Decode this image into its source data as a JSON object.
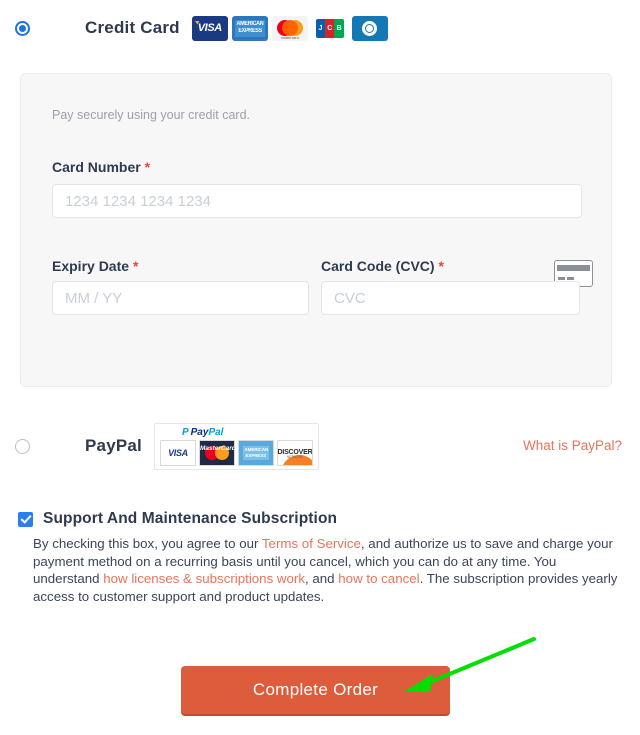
{
  "payment_methods": [
    {
      "id": "credit-card",
      "label": "Credit Card",
      "selected": true,
      "accepted_cards": [
        "visa",
        "american-express",
        "mastercard",
        "jcb",
        "diners-club"
      ]
    },
    {
      "id": "paypal",
      "label": "PayPal",
      "selected": false,
      "help_link": "What is PayPal?",
      "acceptance_mark": {
        "brand": "PayPal",
        "brand_part_1": "Pay",
        "brand_part_2": "Pal",
        "cards": [
          "VISA",
          "MasterCard",
          "AMERICAN EXPRESS",
          "DISCOVER"
        ]
      }
    }
  ],
  "credit_card_panel": {
    "note": "Pay securely using your credit card.",
    "required_marker": "*",
    "fields": {
      "card_number": {
        "label": "Card Number",
        "placeholder": "1234 1234 1234 1234",
        "value": "",
        "required": true,
        "icon": "credit-card-icon"
      },
      "expiry": {
        "label": "Expiry Date",
        "placeholder": "MM / YY",
        "value": "",
        "required": true
      },
      "cvc": {
        "label": "Card Code (CVC)",
        "placeholder": "CVC",
        "value": "",
        "required": true
      }
    }
  },
  "subscription": {
    "checked": true,
    "title": "Support And Maintenance Subscription",
    "text_1": "By checking this box, you agree to our ",
    "link_1": "Terms of Service",
    "text_2": ", and authorize us to save and charge your payment method on a recurring basis until you cancel, which you can do at any time. You understand ",
    "link_2": "how licenses & subscriptions work",
    "text_3": ", and ",
    "link_3": "how to cancel",
    "text_4": ". The subscription provides yearly access to customer support and product updates."
  },
  "submit": {
    "label": "Complete Order"
  },
  "annotation": {
    "type": "arrow",
    "color": "#00e000",
    "points_at": "complete-order-button"
  },
  "colors": {
    "accent_orange": "#dd5c3b",
    "link_coral": "#e8735a",
    "radio_blue": "#1a73e8",
    "checkbox_blue": "#2a7ef0",
    "required_red": "#e8453c",
    "panel_bg": "#f7f7f8"
  }
}
